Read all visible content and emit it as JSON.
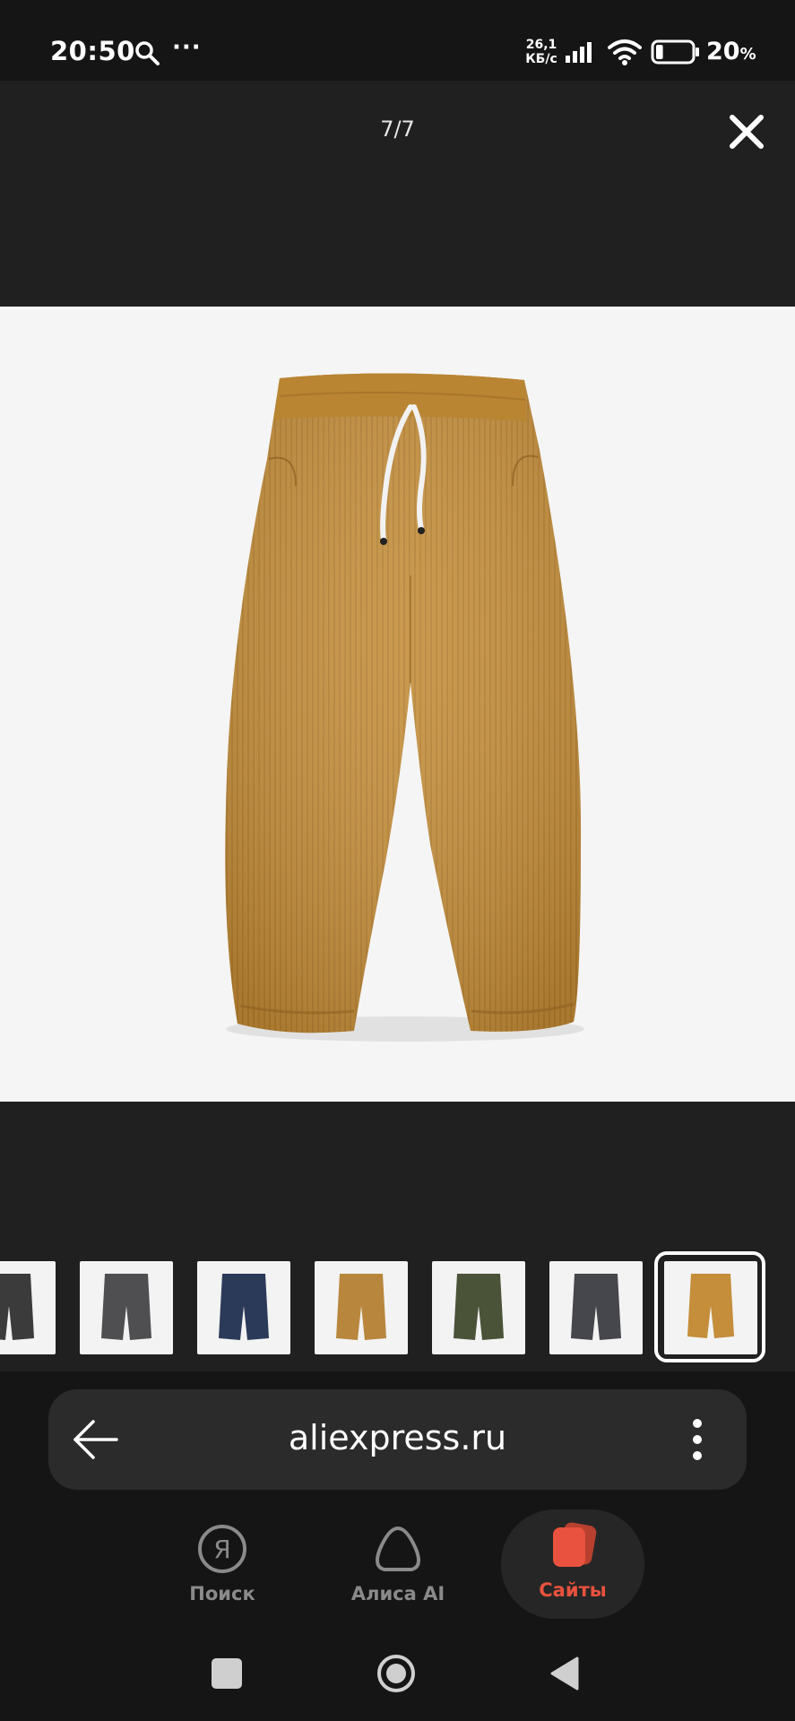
{
  "status_bar": {
    "time": "20:50",
    "speed_value": "26,1",
    "speed_unit": "КБ/с",
    "battery_percent": "20",
    "battery_percent_symbol": "%",
    "battery_level": 0.2
  },
  "viewer": {
    "page_counter": "7/7",
    "current_index": 7,
    "total": 7
  },
  "thumbnails": [
    {
      "name": "thumb-dark-grey-partial",
      "fabric": "#3b3b3b"
    },
    {
      "name": "thumb-grey",
      "fabric": "#4f4f52"
    },
    {
      "name": "thumb-navy",
      "fabric": "#2c3a5a"
    },
    {
      "name": "thumb-tan",
      "fabric": "#b8873d"
    },
    {
      "name": "thumb-olive",
      "fabric": "#4a5238"
    },
    {
      "name": "thumb-charcoal",
      "fabric": "#46474c"
    },
    {
      "name": "thumb-mustard-selected",
      "fabric": "#c48e3a"
    }
  ],
  "browser": {
    "url": "aliexpress.ru"
  },
  "bottom_nav": {
    "search_label": "Поиск",
    "alice_label": "Алиса AI",
    "sites_label": "Сайты"
  },
  "colors": {
    "accent": "#e8523e",
    "product": "#c48e3a"
  }
}
